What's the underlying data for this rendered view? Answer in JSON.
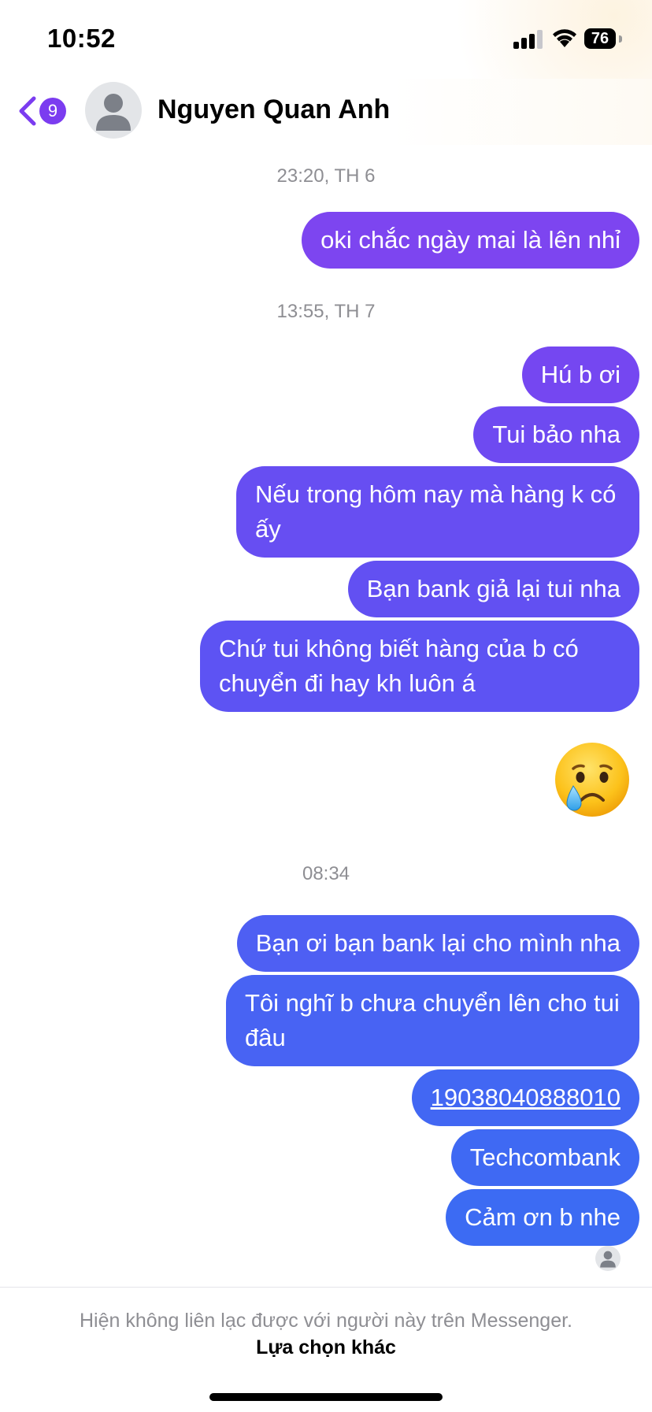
{
  "status_bar": {
    "time": "10:52",
    "battery": "76",
    "icons": [
      "signal-icon",
      "wifi-icon",
      "battery-icon"
    ]
  },
  "header": {
    "back_badge": "9",
    "contact_name": "Nguyen Quan Anh",
    "accent_color": "#7b3cf0"
  },
  "timestamps": {
    "t1": "23:20, TH 6",
    "t2": "13:55, TH 7",
    "t3": "08:34"
  },
  "messages": {
    "m1": "oki chắc ngày mai là lên nhỉ",
    "m2": "Hú b ơi",
    "m3": "Tui bảo nha",
    "m4": "Nếu trong hôm nay mà hàng k có ấy",
    "m5": "Bạn bank giả lại tui nha",
    "m6": "Chứ tui không biết hàng của b có chuyển đi hay kh luôn á",
    "m7": "😢",
    "m8": "Bạn ơi bạn bank lại cho mình nha",
    "m9": "Tôi nghĩ b chưa chuyển lên cho tui đâu",
    "m10": "19038040888010",
    "m11": "Techcombank",
    "m12": "Cảm ơn b nhe"
  },
  "bubble_colors": {
    "purple": "#7d45f0",
    "violet": "#6650f2",
    "indigo": "#5a55f3",
    "blue": "#4b63f2",
    "blue2": "#3f6cf3"
  },
  "footer": {
    "notice": "Hiện không liên lạc được với người này trên Messenger.",
    "action": "Lựa chọn khác"
  }
}
